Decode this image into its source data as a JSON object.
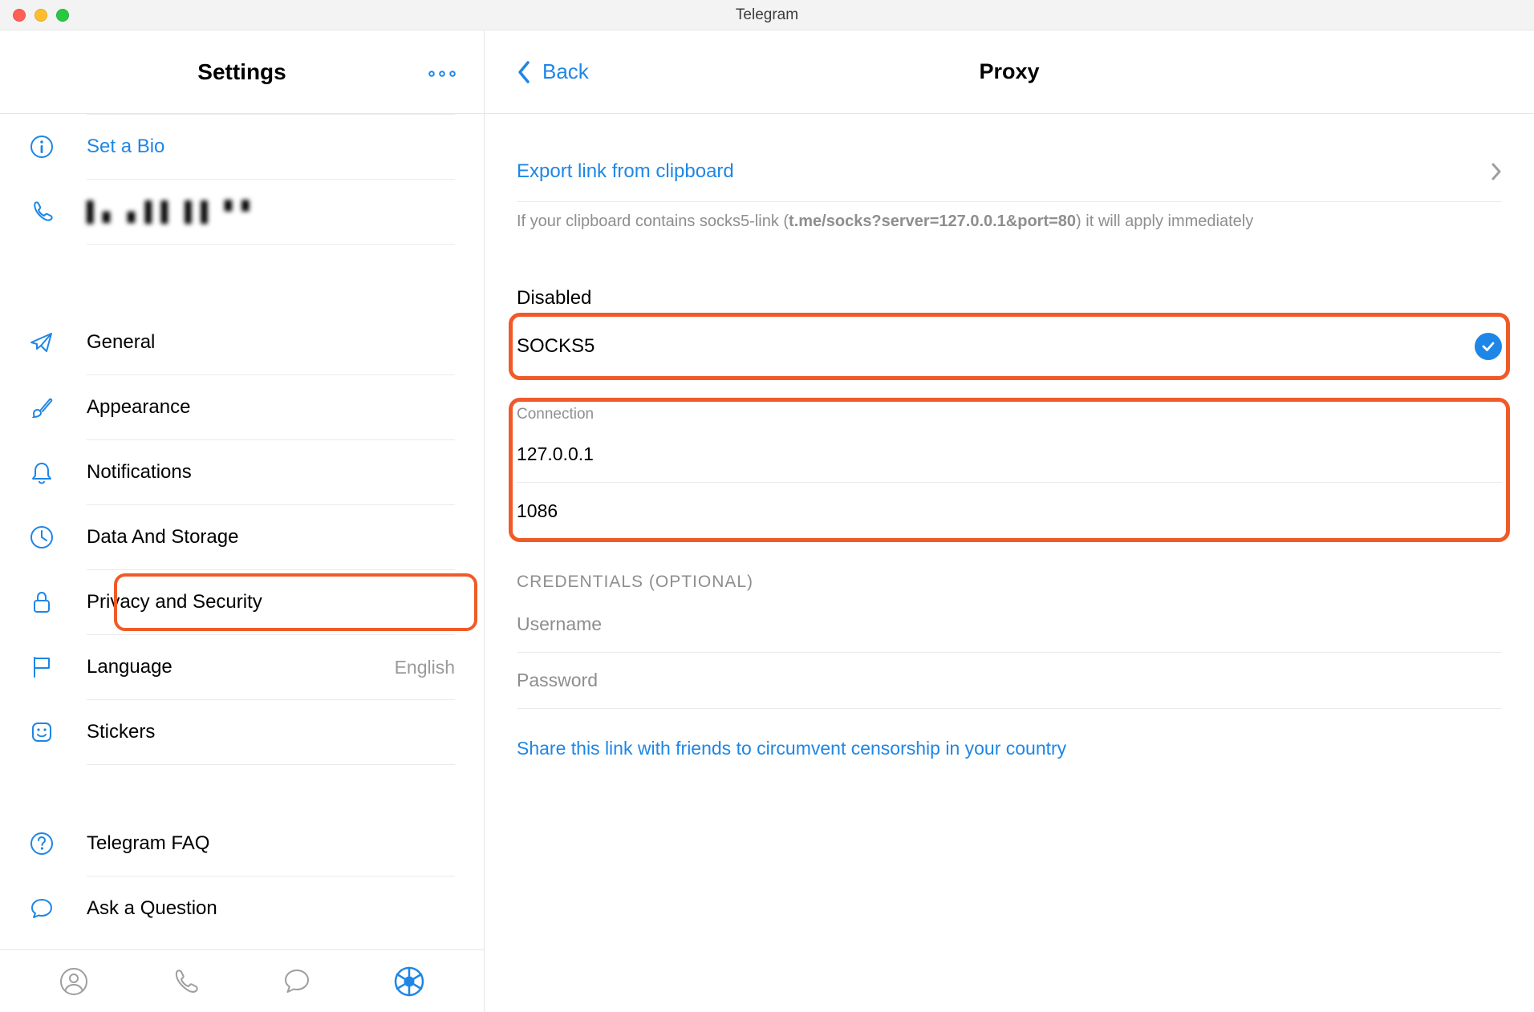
{
  "window": {
    "title": "Telegram"
  },
  "sidebar": {
    "title": "Settings",
    "more_label": "ooo",
    "items": {
      "set_bio": "Set a Bio",
      "phone": "▌▖▗ ▌▌ ▌▌ ▘▘",
      "general": "General",
      "appearance": "Appearance",
      "notifications": "Notifications",
      "data_storage": "Data And Storage",
      "privacy_security": "Privacy and Security",
      "language": "Language",
      "language_value": "English",
      "stickers": "Stickers",
      "faq": "Telegram FAQ",
      "ask": "Ask a Question"
    }
  },
  "content": {
    "back_label": "Back",
    "title": "Proxy",
    "export_link": "Export link from clipboard",
    "hint_prefix": "If your clipboard contains socks5-link (",
    "hint_link": "t.me/socks?server=127.0.0.1&port=80",
    "hint_suffix": ") it will apply immediately",
    "proxy_state_heading": "Disabled",
    "proxy_type": "SOCKS5",
    "connection_label": "Connection",
    "host": "127.0.0.1",
    "port": "1086",
    "credentials_label": "CREDENTIALS (OPTIONAL)",
    "username_placeholder": "Username",
    "password_placeholder": "Password",
    "share_link_text": "Share this link with friends to circumvent censorship in your country"
  }
}
